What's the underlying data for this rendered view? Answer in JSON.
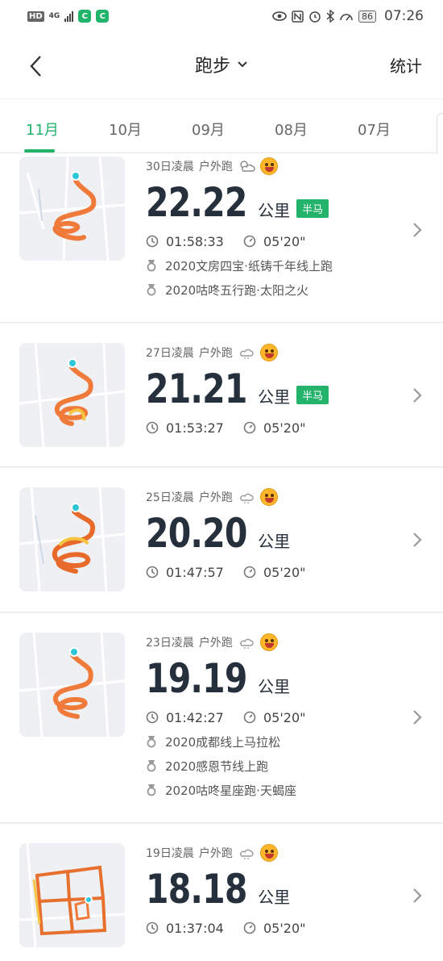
{
  "status_bar": {
    "hd": "HD",
    "net": "4G",
    "battery": "86",
    "time": "07:26"
  },
  "nav": {
    "title": "跑步",
    "right_label": "统计"
  },
  "tabs": [
    "11月",
    "10月",
    "09月",
    "08月",
    "07月"
  ],
  "active_tab": "11月",
  "accent_color": "#23b36a",
  "runs": [
    {
      "date": "30日凌晨",
      "type": "户外跑",
      "weather": "partly-cloudy-icon",
      "distance": "22.22",
      "unit": "公里",
      "badge": "半马",
      "duration": "01:58:33",
      "pace": "05'20\"",
      "medals": [
        "2020文房四宝·纸铸千年线上跑",
        "2020咕咚五行跑·太阳之火"
      ]
    },
    {
      "date": "27日凌晨",
      "type": "户外跑",
      "weather": "cloudy-icon",
      "distance": "21.21",
      "unit": "公里",
      "badge": "半马",
      "duration": "01:53:27",
      "pace": "05'20\"",
      "medals": []
    },
    {
      "date": "25日凌晨",
      "type": "户外跑",
      "weather": "cloudy-icon",
      "distance": "20.20",
      "unit": "公里",
      "badge": "",
      "duration": "01:47:57",
      "pace": "05'20\"",
      "medals": []
    },
    {
      "date": "23日凌晨",
      "type": "户外跑",
      "weather": "cloudy-icon",
      "distance": "19.19",
      "unit": "公里",
      "badge": "",
      "duration": "01:42:27",
      "pace": "05'20\"",
      "medals": [
        "2020成都线上马拉松",
        "2020感恩节线上跑",
        "2020咕咚星座跑·天蝎座"
      ]
    },
    {
      "date": "19日凌晨",
      "type": "户外跑",
      "weather": "cloudy-icon",
      "distance": "18.18",
      "unit": "公里",
      "badge": "",
      "duration": "01:37:04",
      "pace": "05'20\"",
      "medals": []
    }
  ]
}
